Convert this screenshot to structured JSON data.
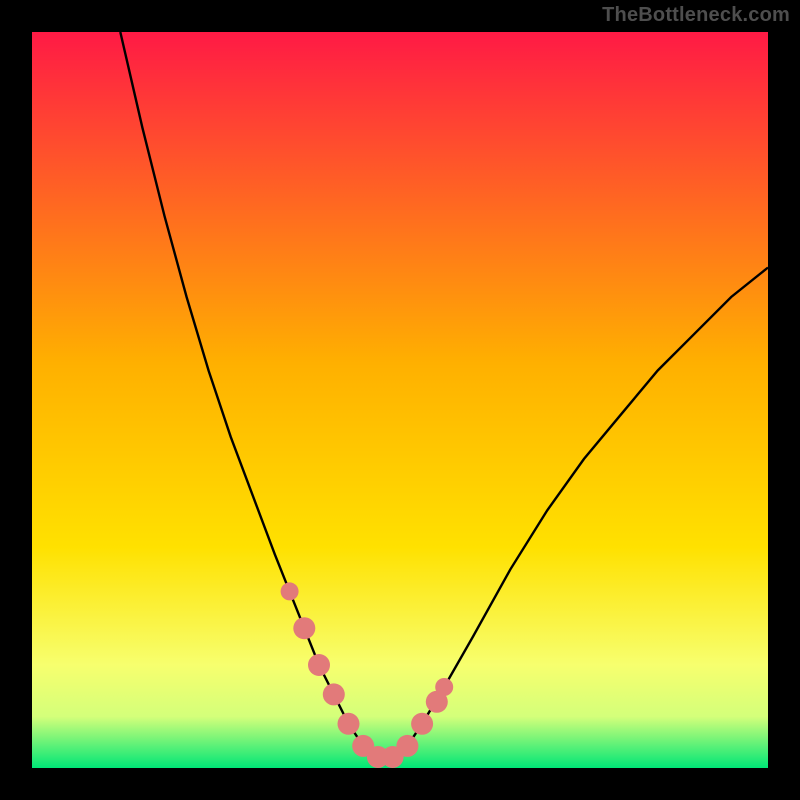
{
  "watermark": "TheBottleneck.com",
  "colors": {
    "bg": "#000000",
    "grad_top": "#ff1a45",
    "grad_mid": "#ffd400",
    "grad_low": "#f7ff6e",
    "grad_bottom": "#00e676",
    "curve": "#000000",
    "dots": "#e27a7a"
  },
  "chart_data": {
    "type": "line",
    "title": "",
    "xlabel": "",
    "ylabel": "",
    "xlim": [
      0,
      100
    ],
    "ylim": [
      0,
      100
    ],
    "series": [
      {
        "name": "bottleneck-curve",
        "x": [
          12,
          15,
          18,
          21,
          24,
          27,
          30,
          33,
          35,
          37,
          39,
          41,
          43,
          45,
          47,
          49,
          51,
          53,
          56,
          60,
          65,
          70,
          75,
          80,
          85,
          90,
          95,
          100
        ],
        "y": [
          100,
          87,
          75,
          64,
          54,
          45,
          37,
          29,
          24,
          19,
          14,
          10,
          6,
          3,
          1.5,
          1.5,
          3,
          6,
          11,
          18,
          27,
          35,
          42,
          48,
          54,
          59,
          64,
          68
        ]
      }
    ],
    "marker_points": {
      "name": "highlight-dots",
      "x": [
        35,
        37,
        39,
        41,
        43,
        45,
        47,
        49,
        51,
        53,
        55,
        56
      ],
      "y": [
        24,
        19,
        14,
        10,
        6,
        3,
        1.5,
        1.5,
        3,
        6,
        9,
        11
      ]
    },
    "gradient_stops": [
      {
        "offset": 0.0,
        "color": "#ff1a45"
      },
      {
        "offset": 0.45,
        "color": "#ffb000"
      },
      {
        "offset": 0.7,
        "color": "#ffe100"
      },
      {
        "offset": 0.86,
        "color": "#f7ff6e"
      },
      {
        "offset": 0.93,
        "color": "#d4ff7a"
      },
      {
        "offset": 1.0,
        "color": "#00e676"
      }
    ]
  }
}
